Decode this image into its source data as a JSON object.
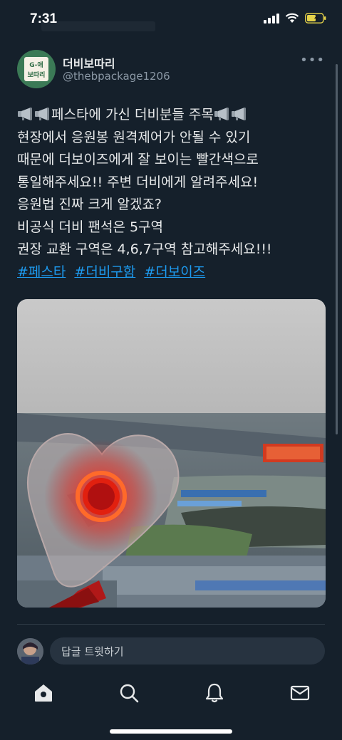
{
  "status_bar": {
    "time": "7:31"
  },
  "tweet": {
    "display_name": "더비보따리",
    "handle": "@thebpackage1206",
    "avatar_text_top": "G-애",
    "avatar_text_bottom": "보따리",
    "text_lines": [
      "페스타에 가신 더비분들 주목",
      "현장에서 응원봉 원격제어가 안될 수 있기",
      "때문에 더보이즈에게 잘 보이는 빨간색으로",
      "통일해주세요!! 주변 더비에게 알려주세요!",
      "응원법 진짜 크게 알겠죠?",
      "비공식 더비 팬석은 5구역",
      "권장 교환 구역은 4,6,7구역 참고해주세요!!!"
    ],
    "hashtags": [
      "#페스타",
      "#더비구함",
      "#더보이즈"
    ]
  },
  "reply": {
    "placeholder": "답글 트윗하기"
  },
  "colors": {
    "background": "#15202b",
    "link": "#1d9bf0",
    "text": "#e7e9ea",
    "secondary": "#8b98a5"
  },
  "icons": [
    "signal-icon",
    "wifi-icon",
    "battery-icon",
    "megaphone-icon",
    "more-icon",
    "home-icon",
    "search-icon",
    "bell-icon",
    "mail-icon"
  ]
}
